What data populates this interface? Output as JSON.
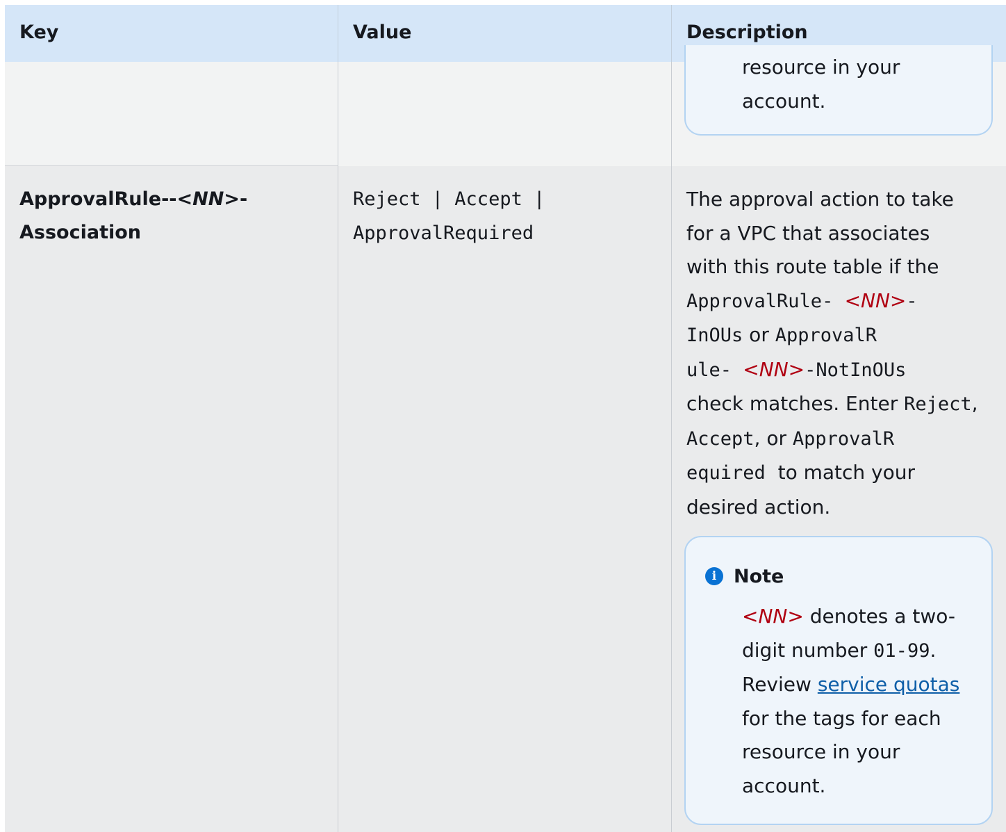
{
  "table": {
    "headers": {
      "key": "Key",
      "value": "Value",
      "description": "Description"
    }
  },
  "prev_row": {
    "note_tail": [
      "resource in your",
      "account."
    ]
  },
  "row": {
    "key_line1": "ApprovalRule--",
    "key_ph": "<NN>",
    "key_dash": "-",
    "key_line2": "Association",
    "value_line1": "Reject | Accept |",
    "value_line2": "ApprovalRequired",
    "desc": {
      "l1": "The approval action to take",
      "l2": "for a VPC that associates",
      "l3": "with this route table if the",
      "l4_code": "ApprovalRule- ",
      "l4_ph": "<NN>",
      "l4_dash": "-",
      "l5_code1": "InOUs",
      "l5_text": " or ",
      "l5_code2": "ApprovalR",
      "l6_code1": "ule- ",
      "l6_ph": "<NN>",
      "l6_code2": "-NotInOUs",
      "l7_text": "check matches. Enter ",
      "l7_code": "Reject",
      "l7_comma": ",",
      "l8_code1": "Accept",
      "l8_text": ", or ",
      "l8_code2": "ApprovalR",
      "l9_code": "equired",
      "l9_text": "  to match your",
      "l10": "desired action."
    },
    "note": {
      "title": "Note",
      "icon": "info-icon",
      "l1_ph": "<NN>",
      "l1_text": " denotes a two-",
      "l2_text": "digit number ",
      "l2_code": "01-99",
      "l2_end": ".",
      "l3_text": "Review ",
      "l3_link": "service quotas",
      "l4": "for the tags for each",
      "l5": "resource in your",
      "l6": "account."
    }
  }
}
